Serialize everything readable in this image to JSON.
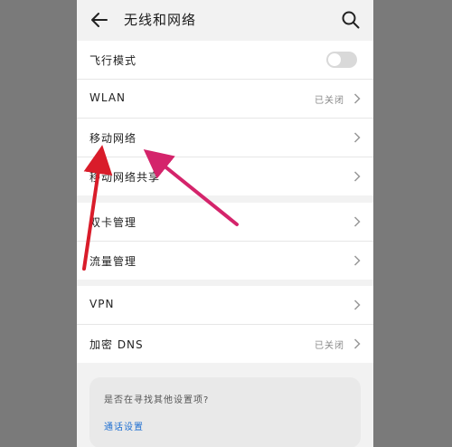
{
  "header": {
    "title": "无线和网络",
    "back_icon": "arrow-left-icon",
    "search_icon": "search-icon"
  },
  "group1": [
    {
      "label": "飞行模式",
      "control": "toggle",
      "state": "off"
    },
    {
      "label": "WLAN",
      "status": "已关闭"
    },
    {
      "label": "移动网络"
    },
    {
      "label": "移动网络共享"
    }
  ],
  "group2": [
    {
      "label": "双卡管理"
    },
    {
      "label": "流量管理"
    }
  ],
  "group3": [
    {
      "label": "VPN"
    },
    {
      "label": "加密 DNS",
      "status": "已关闭"
    }
  ],
  "hint": {
    "question": "是否在寻找其他设置项?",
    "link": "通话设置"
  },
  "colors": {
    "background": "#7a7a7a",
    "screen": "#f2f2f2",
    "link": "#1f6fd1",
    "arrow_red": "#d91c2a",
    "arrow_pink": "#d4246b"
  }
}
